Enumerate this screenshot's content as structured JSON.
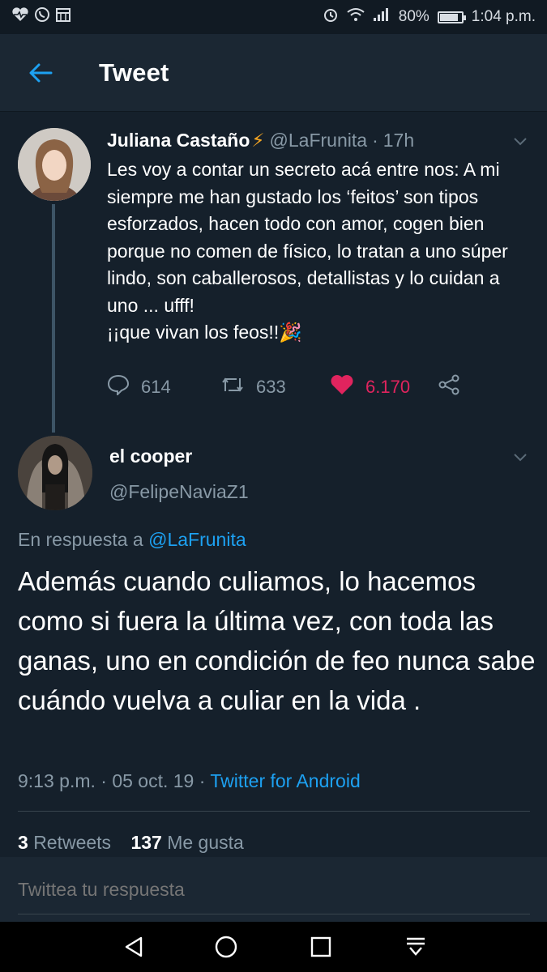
{
  "status_bar": {
    "left_icons": [
      "heart-pulse-icon",
      "whatsapp-icon",
      "calendar-icon"
    ],
    "right_icons": [
      "alarm-icon",
      "wifi-icon",
      "signal-icon",
      "battery-icon"
    ],
    "battery": "80%",
    "time": "1:04 p.m."
  },
  "header": {
    "title": "Tweet"
  },
  "tweet_parent": {
    "name": "Juliana Castaño",
    "emoji": "⚡",
    "handle": "@LaFrunita",
    "separator": "·",
    "time": "17h",
    "body_lines": [
      "Les voy a contar un secreto acá entre nos: A mi siempre me han gustado los ‘feitos’ son tipos esforzados, hacen todo con amor, cogen bien porque no comen de físico, lo tratan a uno súper lindo, son caballerosos, detallistas y lo cuidan a uno ... ufff!",
      "¡¡que vivan los feos!!🎉"
    ],
    "replies": "614",
    "retweets": "633",
    "likes": "6.170"
  },
  "tweet_main": {
    "name": "el cooper",
    "handle": "@FelipeNaviaZ1",
    "reply_prefix": "En respuesta a",
    "reply_handle": "@LaFrunita",
    "body": "Además cuando culiamos, lo hacemos como si fuera la última vez, con toda las ganas, uno en condición de feo nunca sabe cuándo vuelva a culiar en la vida .",
    "timestamp": "9:13 p.m. · 05 oct. 19",
    "meta_separator": " · ",
    "source": "Twitter for Android",
    "retweets_count": "3",
    "retweets_label": "Retweets",
    "likes_count": "137",
    "likes_label": "Me gusta"
  },
  "reply_box": {
    "placeholder": "Twittea tu respuesta"
  },
  "colors": {
    "background": "#15202b",
    "accent": "#1da1f2",
    "like": "#e0245e",
    "muted": "#8899a6"
  }
}
